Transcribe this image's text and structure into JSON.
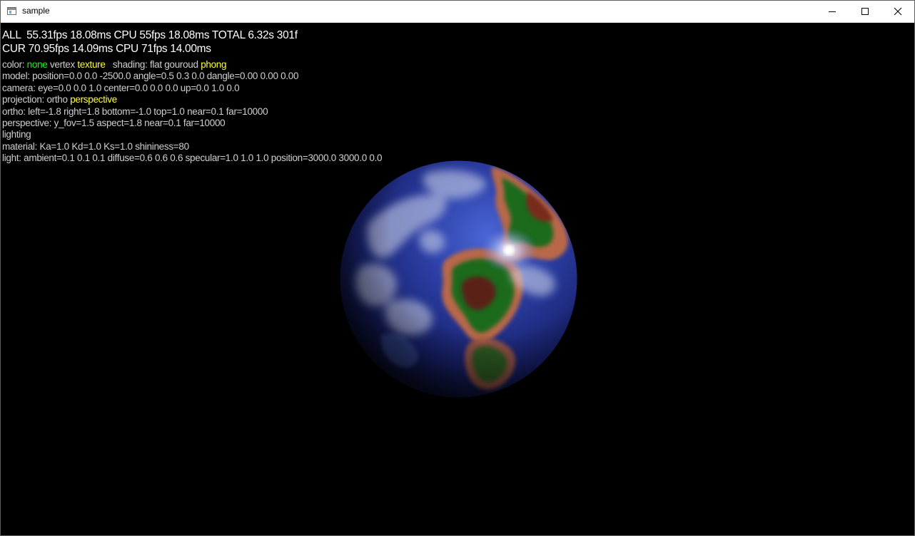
{
  "window": {
    "title": "sample"
  },
  "hud": {
    "all_line": "ALL  55.31fps 18.08ms CPU 55fps 18.08ms TOTAL 6.32s 301f",
    "cur_line": "CUR 70.95fps 14.09ms CPU 71fps 14.00ms",
    "color": {
      "label": "color:",
      "none": "none",
      "vertex": "vertex",
      "texture": "texture"
    },
    "shading": {
      "label": "shading:",
      "flat": "flat",
      "gouroud": "gouroud",
      "phong": "phong"
    },
    "model_line": "model: position=0.0 0.0 -2500.0 angle=0.5 0.3 0.0 dangle=0.00 0.00 0.00",
    "camera_line": "camera: eye=0.0 0.0 1.0 center=0.0 0.0 0.0 up=0.0 1.0 0.0",
    "projection": {
      "label": "projection:",
      "ortho": "ortho",
      "perspective": "perspective"
    },
    "ortho_line": "ortho: left=-1.8 right=1.8 bottom=-1.0 top=1.0 near=0.1 far=10000",
    "perspective_line": "perspective: y_fov=1.5 aspect=1.8 near=0.1 far=10000",
    "lighting": "lighting",
    "material_line": "material: Ka=1.0 Kd=1.0 Ks=1.0 shininess=80",
    "light_line": "light: ambient=0.1 0.1 0.1 diffuse=0.6 0.6 0.6 specular=1.0 1.0 1.0 position=3000.0 3000.0 0.0"
  },
  "colors": {
    "selected_green": "#22ee22",
    "selected_yellow": "#ffff33",
    "hud_text": "#cfcfcf",
    "background": "#000000"
  },
  "icons": [
    "app-icon",
    "minimize-icon",
    "maximize-icon",
    "close-icon"
  ]
}
